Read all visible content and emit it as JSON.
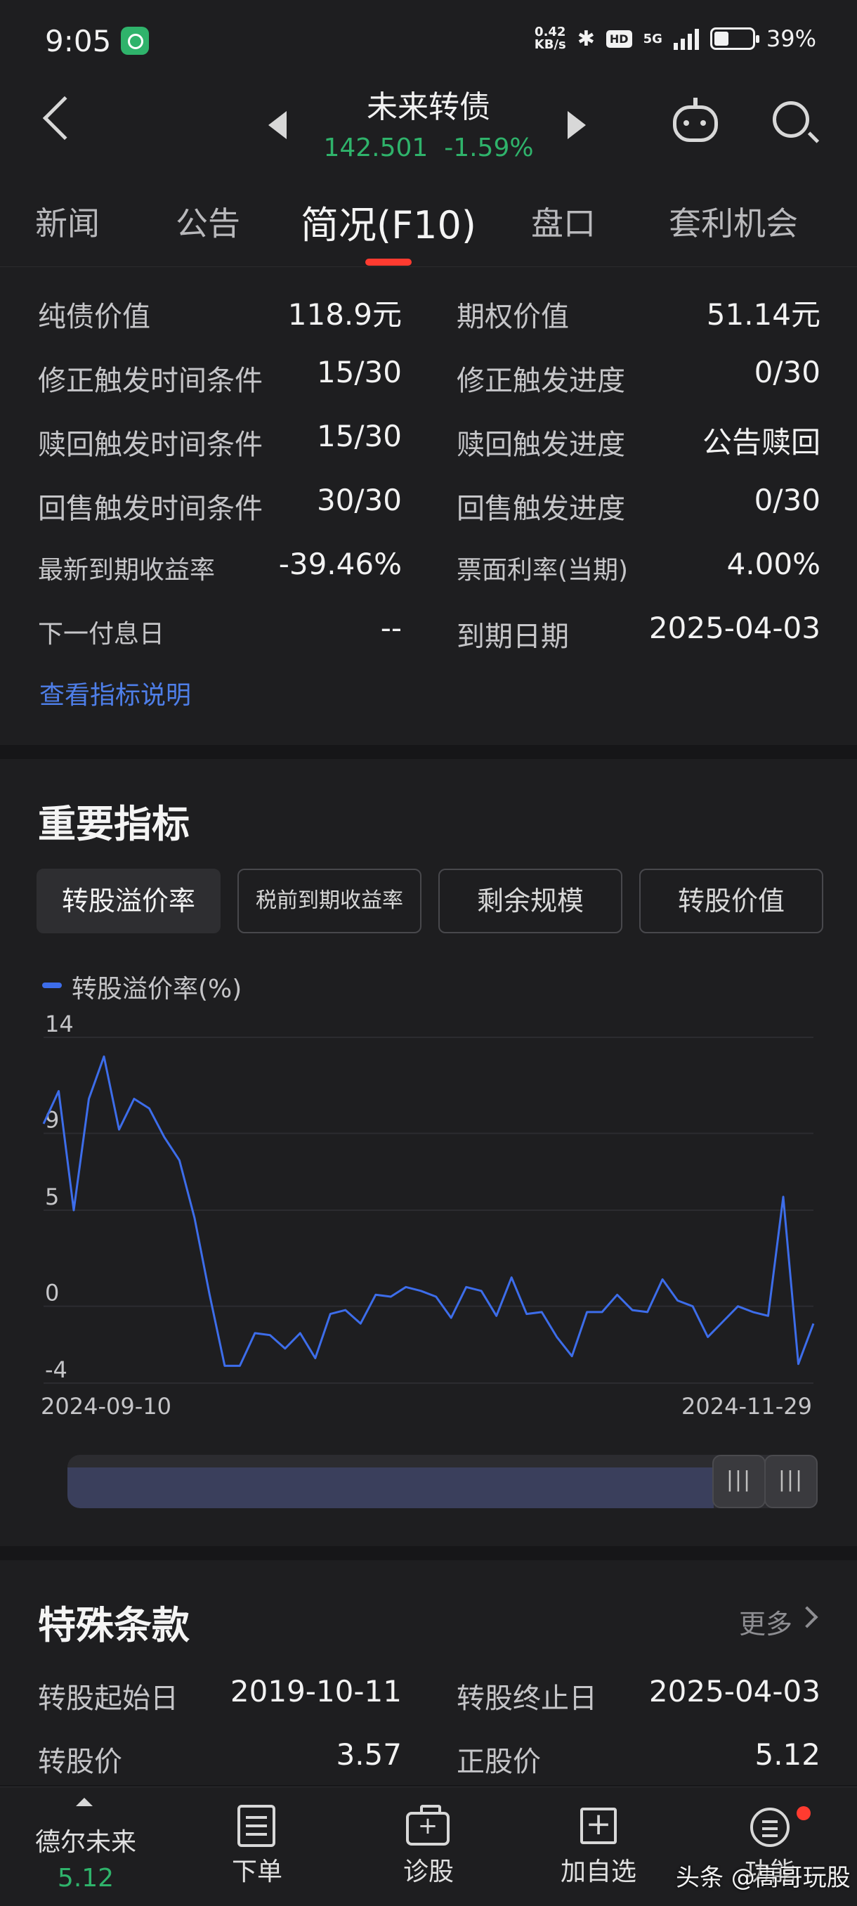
{
  "status_bar": {
    "time": "9:05",
    "net_speed_value": "0.42",
    "net_speed_unit": "KB/s",
    "network": "5G",
    "battery": "39%"
  },
  "header": {
    "title": "未来转债",
    "price": "142.501",
    "change": "-1.59%",
    "price_color": "#2fb36b"
  },
  "tabs": [
    "新闻",
    "公告",
    "简况(F10)",
    "盘口",
    "套利机会"
  ],
  "active_tab": "简况(F10)",
  "info": {
    "left": [
      {
        "label": "纯债价值",
        "value": "118.9元"
      },
      {
        "label": "修正触发时间条件",
        "value": "15/30"
      },
      {
        "label": "赎回触发时间条件",
        "value": "15/30"
      },
      {
        "label": "回售触发时间条件",
        "value": "30/30"
      },
      {
        "label": "最新到期收益率",
        "value": "-39.46%"
      },
      {
        "label": "下一付息日",
        "value": "--"
      }
    ],
    "right": [
      {
        "label": "期权价值",
        "value": "51.14元"
      },
      {
        "label": "修正触发进度",
        "value": "0/30"
      },
      {
        "label": "赎回触发进度",
        "value": "公告赎回"
      },
      {
        "label": "回售触发进度",
        "value": "0/30"
      },
      {
        "label": "票面利率(当期)",
        "value": "4.00%"
      },
      {
        "label": "到期日期",
        "value": "2025-04-03"
      }
    ],
    "link": "查看指标说明"
  },
  "key_indicators": {
    "title": "重要指标",
    "pills": [
      "转股溢价率",
      "税前到期收益率",
      "剩余规模",
      "转股价值"
    ],
    "active_pill": "转股溢价率",
    "legend": "转股溢价率(%)"
  },
  "chart_data": {
    "type": "line",
    "series": [
      {
        "name": "转股溢价率(%)",
        "color": "#3d6dea",
        "values": [
          9.5,
          11.2,
          5.0,
          10.8,
          13.0,
          9.2,
          10.8,
          10.3,
          8.8,
          7.6,
          4.6,
          0.6,
          -3.1,
          -3.1,
          -1.4,
          -1.5,
          -2.2,
          -1.4,
          -2.7,
          -0.4,
          -0.2,
          -0.9,
          0.6,
          0.5,
          1.0,
          0.8,
          0.5,
          -0.6,
          1.0,
          0.8,
          -0.5,
          1.5,
          -0.4,
          -0.3,
          -1.6,
          -2.6,
          -0.3,
          -0.3,
          0.6,
          -0.2,
          -0.3,
          1.4,
          0.3,
          0.0,
          -1.6,
          -0.8,
          0.0,
          -0.3,
          -0.5,
          5.7,
          -3.0,
          -0.9
        ]
      }
    ],
    "ylim": [
      -4,
      14
    ],
    "yticks": [
      "14",
      "9",
      "5",
      "0",
      "-4"
    ],
    "x_start": "2024-09-10",
    "x_end": "2024-11-29",
    "grid": true
  },
  "special_clauses": {
    "title": "特殊条款",
    "more": "更多",
    "rows": [
      {
        "label": "转股起始日",
        "value": "2019-10-11",
        "label2": "转股终止日",
        "value2": "2025-04-03"
      },
      {
        "label": "转股价",
        "value": "3.57",
        "label2": "正股价",
        "value2": "5.12"
      }
    ]
  },
  "bottom_bar": {
    "stock_name": "德尔未来",
    "stock_price": "5.12",
    "items": [
      "下单",
      "诊股",
      "加自选",
      "功能"
    ],
    "watermark": "头条 @高哥玩股"
  }
}
